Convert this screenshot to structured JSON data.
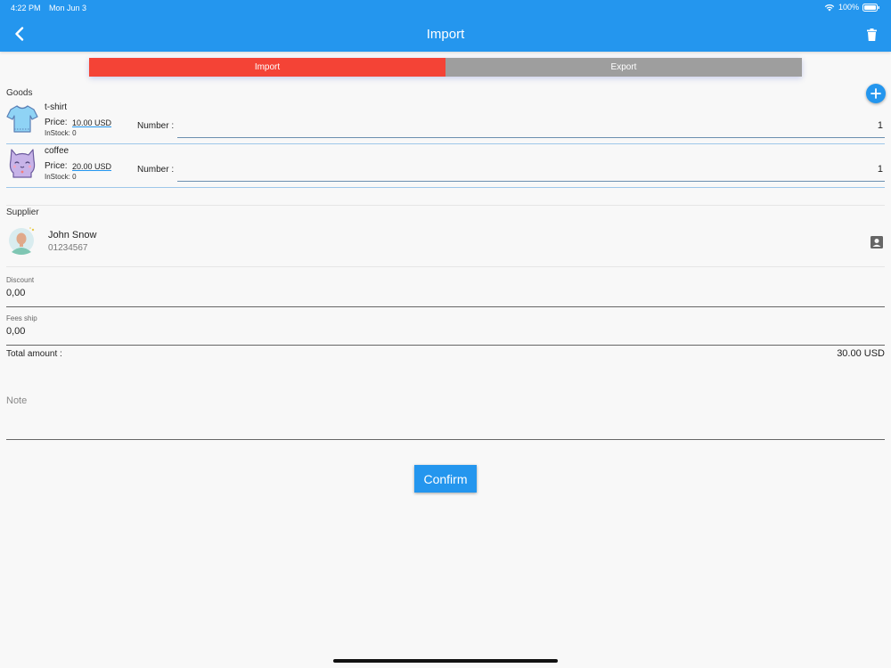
{
  "status_bar": {
    "time": "4:22 PM",
    "date": "Mon Jun 3",
    "battery": "100%"
  },
  "app_bar": {
    "title": "Import",
    "back_icon": "chevron-left-icon",
    "delete_icon": "trash-icon"
  },
  "tabs": [
    {
      "label": "Import",
      "active": true
    },
    {
      "label": "Export",
      "active": false
    }
  ],
  "goods": {
    "section_label": "Goods",
    "add_icon": "plus-circle-icon",
    "items": [
      {
        "name": "t-shirt",
        "price_label": "Price:",
        "price": "10.00 USD",
        "stock": "InStock: 0",
        "number_label": "Number :",
        "number": "1",
        "icon": "tshirt-icon"
      },
      {
        "name": "coffee",
        "price_label": "Price:",
        "price": "20.00 USD",
        "stock": "InStock: 0",
        "number_label": "Number :",
        "number": "1",
        "icon": "cat-icon"
      }
    ]
  },
  "supplier": {
    "section_label": "Supplier",
    "name": "John Snow",
    "phone": "01234567",
    "contact_icon": "contact-card-icon"
  },
  "discount": {
    "label": "Discount",
    "value": "0,00"
  },
  "fees_ship": {
    "label": "Fees ship",
    "value": "0,00"
  },
  "total": {
    "label": "Total amount :",
    "value": "30.00 USD"
  },
  "note": {
    "placeholder": "Note",
    "value": ""
  },
  "confirm": {
    "label": "Confirm"
  },
  "colors": {
    "primary": "#2496ee",
    "import_tab": "#f44336",
    "export_tab": "#9e9e9e"
  }
}
